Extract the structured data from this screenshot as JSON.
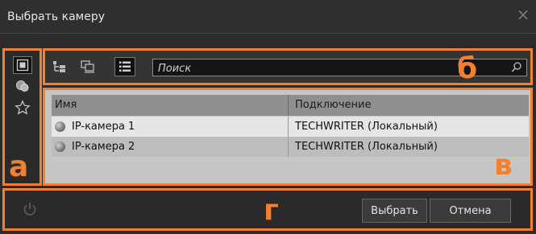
{
  "window": {
    "title": "Выбрать камеру",
    "close_glyph": "×"
  },
  "sidebar": {
    "items": [
      {
        "icon": "camera-list-icon",
        "active": true
      },
      {
        "icon": "camera-group-icon",
        "active": false
      },
      {
        "icon": "star-icon",
        "active": false
      }
    ]
  },
  "toolbar": {
    "buttons": [
      {
        "icon": "tree-view-icon",
        "active": false
      },
      {
        "icon": "monitors-view-icon",
        "active": false
      },
      {
        "icon": "list-view-icon",
        "active": true
      }
    ],
    "search": {
      "placeholder": "Поиск",
      "value": ""
    }
  },
  "table": {
    "columns": [
      "Имя",
      "Подключение"
    ],
    "rows": [
      {
        "name": "IP-камера 1",
        "connection": "TECHWRITER (Локальный)",
        "selected": true
      },
      {
        "name": "IP-камера 2",
        "connection": "TECHWRITER (Локальный)",
        "selected": false
      }
    ]
  },
  "footer": {
    "select_label": "Выбрать",
    "cancel_label": "Отмена",
    "power_icon": "power-icon"
  },
  "annotations": {
    "a": "а",
    "b": "б",
    "v": "в",
    "g": "г"
  },
  "colors": {
    "accent": "#f2802f",
    "background": "#2b2b2b",
    "table_bg": "#c6c6c6"
  }
}
